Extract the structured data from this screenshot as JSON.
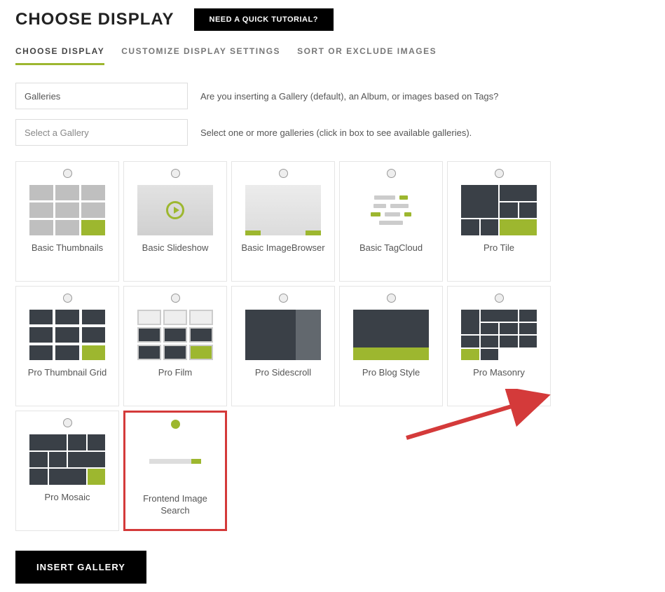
{
  "header": {
    "title": "CHOOSE DISPLAY",
    "tutorial_button": "NEED A QUICK TUTORIAL?"
  },
  "tabs": [
    {
      "label": "CHOOSE DISPLAY",
      "active": true
    },
    {
      "label": "CUSTOMIZE DISPLAY SETTINGS",
      "active": false
    },
    {
      "label": "SORT OR EXCLUDE IMAGES",
      "active": false
    }
  ],
  "form": {
    "source_select_value": "Galleries",
    "source_help": "Are you inserting a Gallery (default), an Album, or images based on Tags?",
    "gallery_select_placeholder": "Select a Gallery",
    "gallery_help": "Select one or more galleries (click in box to see available galleries)."
  },
  "display_options": [
    {
      "label": "Basic Thumbnails",
      "selected": false
    },
    {
      "label": "Basic Slideshow",
      "selected": false
    },
    {
      "label": "Basic ImageBrowser",
      "selected": false
    },
    {
      "label": "Basic TagCloud",
      "selected": false
    },
    {
      "label": "Pro Tile",
      "selected": false
    },
    {
      "label": "Pro Thumbnail Grid",
      "selected": false
    },
    {
      "label": "Pro Film",
      "selected": false
    },
    {
      "label": "Pro Sidescroll",
      "selected": false
    },
    {
      "label": "Pro Blog Style",
      "selected": false
    },
    {
      "label": "Pro Masonry",
      "selected": false
    },
    {
      "label": "Pro Mosaic",
      "selected": false
    },
    {
      "label": "Frontend Image Search",
      "selected": true,
      "highlighted": true
    }
  ],
  "footer": {
    "insert_button": "INSERT GALLERY"
  },
  "colors": {
    "accent": "#9db72f",
    "highlight_border": "#d43a3a",
    "dark_tile": "#3a4047"
  }
}
